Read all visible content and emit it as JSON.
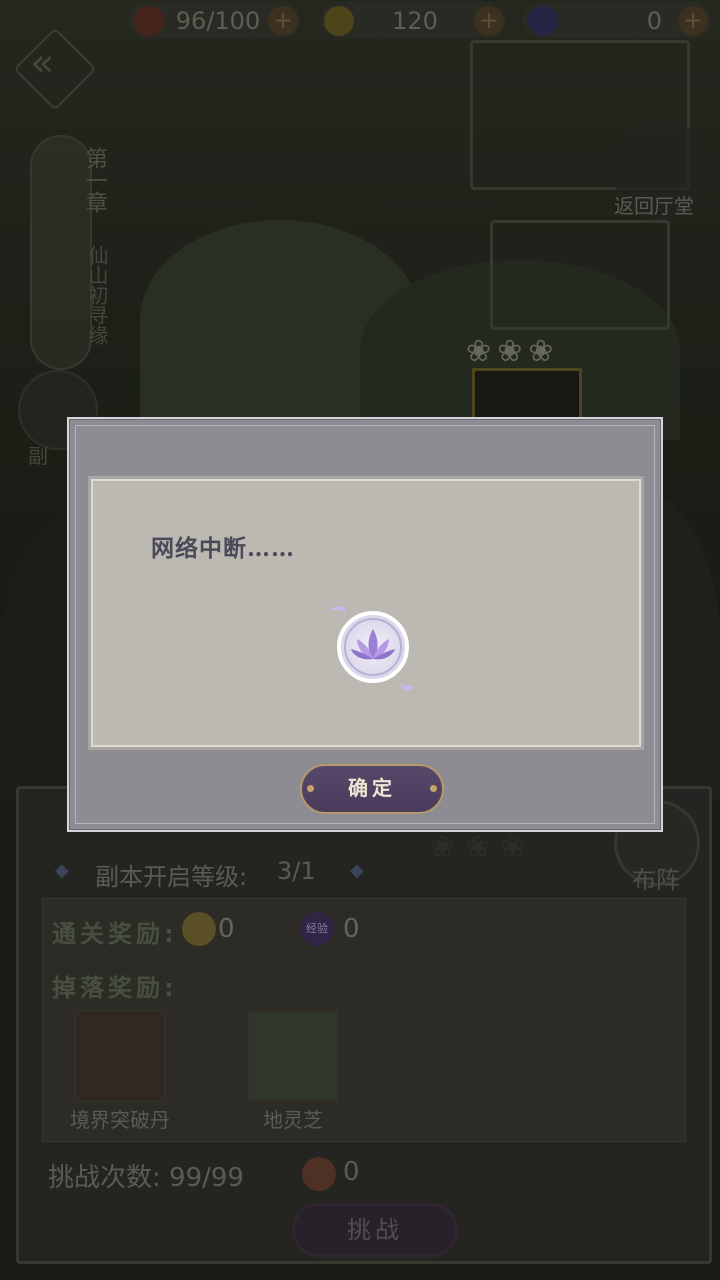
{
  "resources": {
    "stamina": "96/100",
    "coins": "120",
    "gems": "0",
    "plus_symbol": "+"
  },
  "chapter": {
    "number": "第一章",
    "name": "仙山初寻缘"
  },
  "nav": {
    "return_hall": "返回厅堂",
    "left_button": "副"
  },
  "panel": {
    "open_level_label": "副本开启等级:",
    "open_level_value": "3/1",
    "clear_reward_label": "通关奖励:",
    "clear_coin_value": "0",
    "clear_exp_value": "0",
    "exp_icon_text": "经验",
    "drop_reward_label": "掉落奖励:",
    "drops": [
      {
        "name": "境界突破丹"
      },
      {
        "name": "地灵芝"
      }
    ],
    "challenge_count": "挑战次数: 99/99",
    "peach_value": "0",
    "challenge_button": "挑战",
    "formation_button": "布阵"
  },
  "modal": {
    "message": "网络中断……",
    "confirm_button": "确定"
  }
}
